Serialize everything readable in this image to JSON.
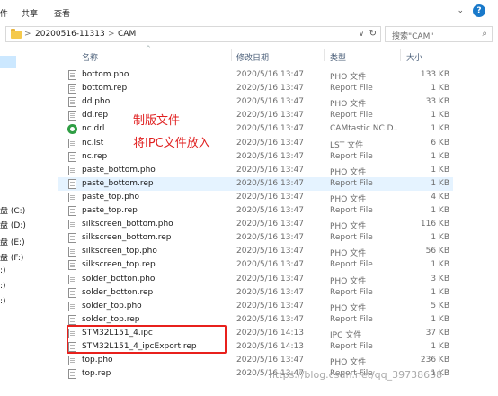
{
  "ribbon": {
    "tabs": [
      "件",
      "共享",
      "查看"
    ],
    "help": "?"
  },
  "address": {
    "path": [
      "20200516-11313",
      "CAM"
    ],
    "separator": ">",
    "search_placeholder": "搜索\"CAM\""
  },
  "nav": {
    "drives": [
      "盘 (C:)",
      "盘 (D:)",
      "盘 (E:)",
      "盘 (F:)",
      ":)",
      ":)",
      ":)"
    ]
  },
  "columns": {
    "name": "名称",
    "date": "修改日期",
    "type": "类型",
    "size": "大小"
  },
  "files": [
    {
      "name": "bottom.pho",
      "date": "2020/5/16 13:47",
      "type": "PHO 文件",
      "size": "133 KB",
      "icon": "document-icon"
    },
    {
      "name": "bottom.rep",
      "date": "2020/5/16 13:47",
      "type": "Report File",
      "size": "1 KB",
      "icon": "document-icon"
    },
    {
      "name": "dd.pho",
      "date": "2020/5/16 13:47",
      "type": "PHO 文件",
      "size": "33 KB",
      "icon": "document-icon"
    },
    {
      "name": "dd.rep",
      "date": "2020/5/16 13:47",
      "type": "Report File",
      "size": "1 KB",
      "icon": "document-icon"
    },
    {
      "name": "nc.drl",
      "date": "2020/5/16 13:47",
      "type": "CAMtastic NC D...",
      "size": "1 KB",
      "icon": "camtastic-icon"
    },
    {
      "name": "nc.lst",
      "date": "2020/5/16 13:47",
      "type": "LST 文件",
      "size": "6 KB",
      "icon": "document-icon"
    },
    {
      "name": "nc.rep",
      "date": "2020/5/16 13:47",
      "type": "Report File",
      "size": "1 KB",
      "icon": "document-icon"
    },
    {
      "name": "paste_bottom.pho",
      "date": "2020/5/16 13:47",
      "type": "PHO 文件",
      "size": "1 KB",
      "icon": "document-icon"
    },
    {
      "name": "paste_bottom.rep",
      "date": "2020/5/16 13:47",
      "type": "Report File",
      "size": "1 KB",
      "icon": "document-icon"
    },
    {
      "name": "paste_top.pho",
      "date": "2020/5/16 13:47",
      "type": "PHO 文件",
      "size": "4 KB",
      "icon": "document-icon"
    },
    {
      "name": "paste_top.rep",
      "date": "2020/5/16 13:47",
      "type": "Report File",
      "size": "1 KB",
      "icon": "document-icon"
    },
    {
      "name": "silkscreen_bottom.pho",
      "date": "2020/5/16 13:47",
      "type": "PHO 文件",
      "size": "116 KB",
      "icon": "document-icon"
    },
    {
      "name": "silkscreen_bottom.rep",
      "date": "2020/5/16 13:47",
      "type": "Report File",
      "size": "1 KB",
      "icon": "document-icon"
    },
    {
      "name": "silkscreen_top.pho",
      "date": "2020/5/16 13:47",
      "type": "PHO 文件",
      "size": "56 KB",
      "icon": "document-icon"
    },
    {
      "name": "silkscreen_top.rep",
      "date": "2020/5/16 13:47",
      "type": "Report File",
      "size": "1 KB",
      "icon": "document-icon"
    },
    {
      "name": "solder_botton.pho",
      "date": "2020/5/16 13:47",
      "type": "PHO 文件",
      "size": "3 KB",
      "icon": "document-icon"
    },
    {
      "name": "solder_botton.rep",
      "date": "2020/5/16 13:47",
      "type": "Report File",
      "size": "1 KB",
      "icon": "document-icon"
    },
    {
      "name": "solder_top.pho",
      "date": "2020/5/16 13:47",
      "type": "PHO 文件",
      "size": "5 KB",
      "icon": "document-icon"
    },
    {
      "name": "solder_top.rep",
      "date": "2020/5/16 13:47",
      "type": "Report File",
      "size": "1 KB",
      "icon": "document-icon"
    },
    {
      "name": "STM32L151_4.ipc",
      "date": "2020/5/16 14:13",
      "type": "IPC 文件",
      "size": "37 KB",
      "icon": "document-icon"
    },
    {
      "name": "STM32L151_4_ipcExport.rep",
      "date": "2020/5/16 14:13",
      "type": "Report File",
      "size": "1 KB",
      "icon": "document-icon"
    },
    {
      "name": "top.pho",
      "date": "2020/5/16 13:47",
      "type": "PHO 文件",
      "size": "236 KB",
      "icon": "document-icon"
    },
    {
      "name": "top.rep",
      "date": "2020/5/16 13:47",
      "type": "Report File",
      "size": "1 KB",
      "icon": "document-icon"
    }
  ],
  "annotations": {
    "line1": "制版文件",
    "line2": "将IPC文件放入"
  },
  "watermark": "https://blog.csdn.net/qq_39738638",
  "colors": {
    "annotation_red": "#e02020",
    "selection": "#cce8ff",
    "hover_row": "#e5f3ff",
    "header_text": "#4c607a"
  }
}
